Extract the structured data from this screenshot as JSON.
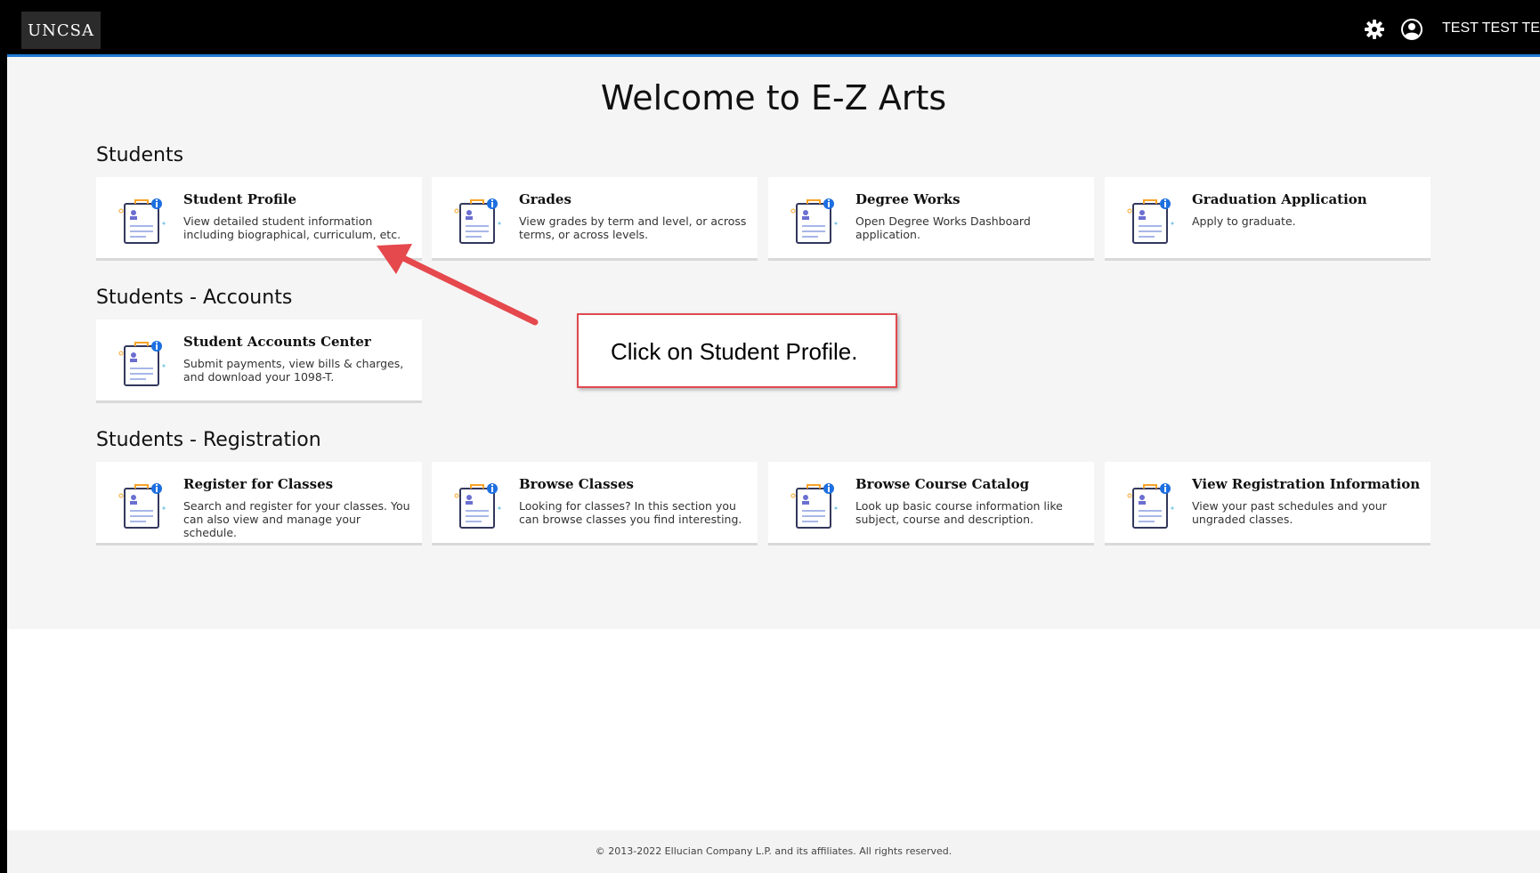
{
  "header": {
    "logo": "UNCSA",
    "user_name": "TEST TEST TEST"
  },
  "page": {
    "title": "Welcome to E-Z Arts"
  },
  "sections": [
    {
      "title": "Students",
      "cards": [
        {
          "title": "Student Profile",
          "desc": "View detailed student information including biographical, curriculum, etc."
        },
        {
          "title": "Grades",
          "desc": "View grades by term and level, or across terms, or across levels."
        },
        {
          "title": "Degree Works",
          "desc": "Open Degree Works Dashboard application."
        },
        {
          "title": "Graduation Application",
          "desc": "Apply to graduate."
        }
      ]
    },
    {
      "title": "Students - Accounts",
      "cards": [
        {
          "title": "Student Accounts Center",
          "desc": "Submit payments, view bills & charges, and download your 1098-T."
        }
      ]
    },
    {
      "title": "Students - Registration",
      "cards": [
        {
          "title": "Register for Classes",
          "desc": "Search and register for your classes. You can also view and manage your schedule."
        },
        {
          "title": "Browse Classes",
          "desc": "Looking for classes? In this section you can browse classes you find interesting."
        },
        {
          "title": "Browse Course Catalog",
          "desc": "Look up basic course information like subject, course and description."
        },
        {
          "title": "View Registration Information",
          "desc": "View your past schedules and your ungraded classes."
        }
      ]
    }
  ],
  "callout": {
    "text": "Click on Student Profile."
  },
  "footer": {
    "text": "© 2013-2022 Ellucian Company L.P. and its affiliates. All rights reserved."
  },
  "colors": {
    "topbar": "#000000",
    "topbar_accent": "#1f7ad6",
    "callout_border": "#e04a4f",
    "arrow": "#e5484d"
  },
  "icons": {
    "header_settings": "gear-icon",
    "header_user": "user-circle-icon",
    "card": "document-info-icon"
  }
}
